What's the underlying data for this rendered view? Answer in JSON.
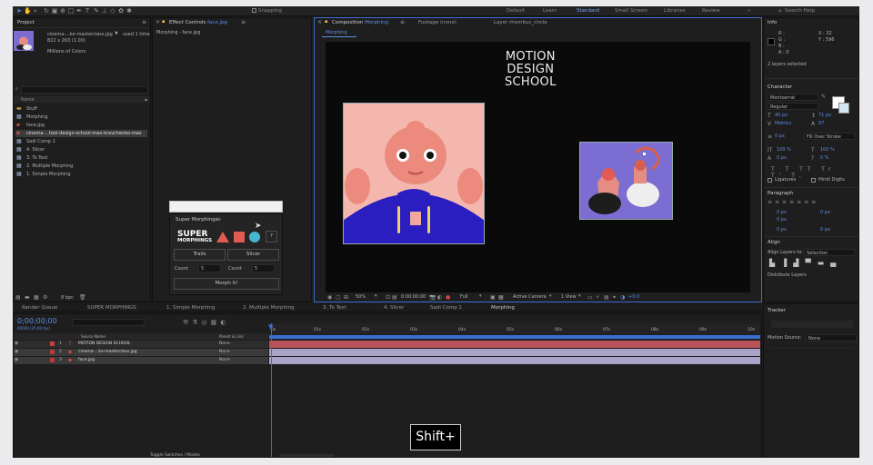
{
  "toolbar": {
    "snapping": "Snapping",
    "workspaces": [
      "Default",
      "Learn",
      "Standard",
      "Small Screen",
      "Libraries",
      "Review"
    ],
    "search_help": "Search Help"
  },
  "project": {
    "tab": "Project",
    "file_name": "cinema-...ko-masterclass.jpg",
    "used": "used 1 time",
    "dims": "822 x 263 (1.00)",
    "colors": "Millions of Colors",
    "col_name": "Name",
    "items": [
      "Stuff",
      "Morphing",
      "face.jpg",
      "cinema-...tool-design-school-max-kravchenko-mas",
      "Sadi Comp 1",
      "4. Slicer",
      "3. To Text",
      "2. Multiple Morphing",
      "1. Simple Morphing"
    ],
    "bpc": "8 bpc"
  },
  "effect_controls": {
    "tab_prefix": "Effect Controls",
    "tab_file": "face.jpg",
    "breadcrumb": "Morphing - face.jpg"
  },
  "super_morphings": {
    "title": "Super Morphings",
    "logo_line1": "SUPER",
    "logo_line2": "MORPHINGS",
    "help": "?",
    "trails": "Trails",
    "slicer": "Slicer",
    "count_label": "Count",
    "count_value": "5",
    "count2_label": "Count",
    "count2_value": "5",
    "morph_button": "Morph it!"
  },
  "composition": {
    "tab": "Composition",
    "tab_name": "Morphing",
    "footage_tab": "Footage (none)",
    "layer_tab": "Layer rhombus_circle",
    "sub_tab": "Morphing",
    "title_lines": [
      "MOTION",
      "DESIGN",
      "SCHOOL"
    ],
    "zoom": "50%",
    "timecode": "0:00:00:00",
    "resolution": "Full",
    "camera": "Active Camera",
    "view": "1 View",
    "exposure": "+0.0"
  },
  "info": {
    "tab": "Info",
    "r": "R :",
    "g": "G :",
    "b": "B :",
    "a": "A : 0",
    "x": "X : 32",
    "y": "Y : 596",
    "selected": "2 layers selected"
  },
  "character": {
    "tab": "Character",
    "font": "Montserrat",
    "style": "Regular",
    "size": "40 px",
    "leading": "71 px",
    "kerning": "Metrics",
    "tracking": "97",
    "stroke_width": "0 px",
    "stroke_type": "Fill Over Stroke",
    "vscale": "100 %",
    "hscale": "100 %",
    "baseline": "0 px",
    "tsume": "0 %",
    "ligatures": "Ligatures",
    "hindi": "Hindi Digits"
  },
  "paragraph": {
    "tab": "Paragraph",
    "v1": "0 px",
    "v2": "0 px",
    "v3": "0 px",
    "v4": "0 px",
    "v5": "0 px"
  },
  "align": {
    "tab": "Align",
    "align_to_label": "Align Layers to:",
    "align_to": "Selection",
    "distribute": "Distribute Layers"
  },
  "tracker": {
    "tab": "Tracker",
    "motion_source_label": "Motion Source:",
    "motion_source": "None"
  },
  "timeline": {
    "tabs": [
      "Render Queue",
      "SUPER MORPHINGS",
      "1. Simple Morphing",
      "2. Multiple Morphing",
      "3. To Text",
      "4. Slicer",
      "Sadi Comp 1",
      "Morphing"
    ],
    "timecode": "0;00;00;00",
    "fps": "00000 (25.00 fps)",
    "col_source": "Source Name",
    "col_parent": "Parent & Link",
    "layers": [
      {
        "num": "1",
        "name": "MOTION DESIGN SCHOOL",
        "parent": "None",
        "color": "#c4413d"
      },
      {
        "num": "2",
        "name": "cinema-...ko-masterclass.jpg",
        "parent": "None",
        "color": "#b53d3a"
      },
      {
        "num": "3",
        "name": "face.jpg",
        "parent": "None",
        "color": "#b53d3a"
      }
    ],
    "ruler": [
      "0s",
      "01s",
      "02s",
      "03s",
      "04s",
      "05s",
      "06s",
      "07s",
      "08s",
      "09s",
      "10s"
    ],
    "toggle": "Toggle Switches / Modes"
  },
  "keystroke": "Shift+"
}
